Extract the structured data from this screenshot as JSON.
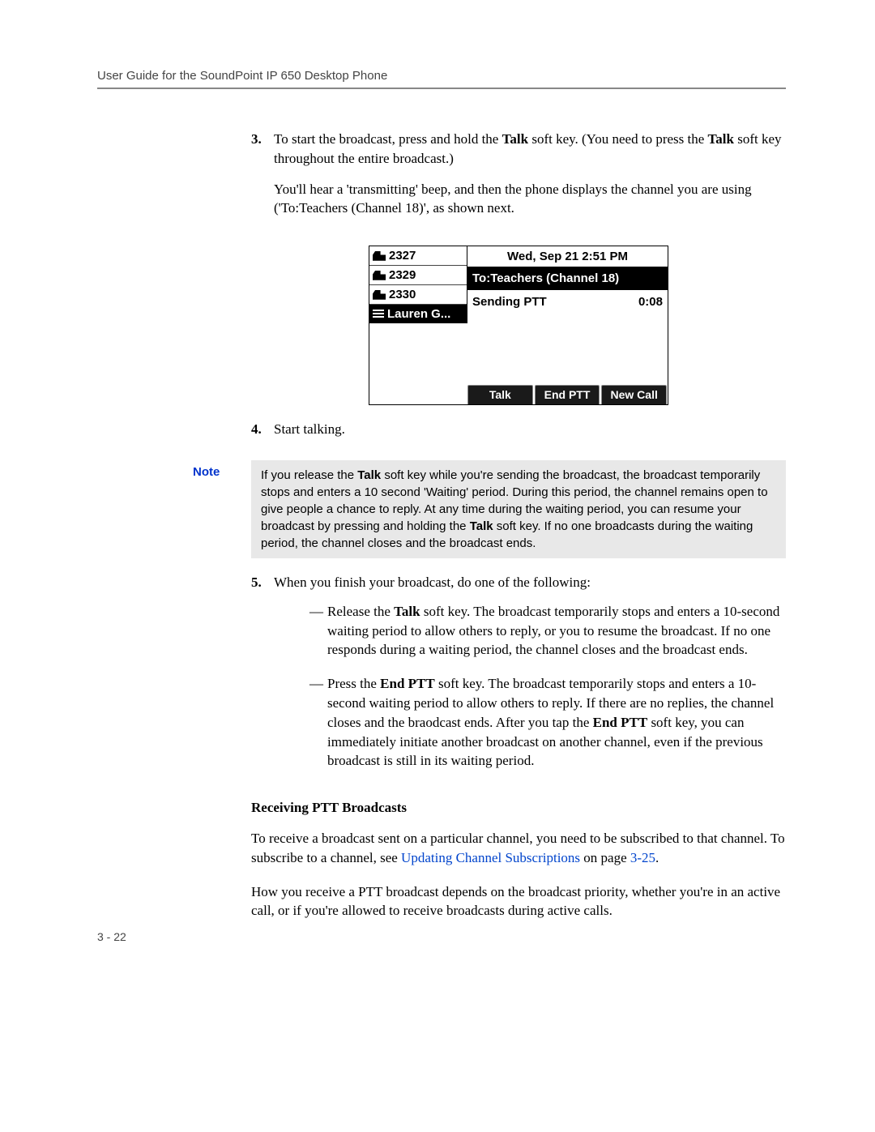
{
  "header": "User Guide for the SoundPoint IP 650 Desktop Phone",
  "step3": {
    "num": "3.",
    "text_a": "To start the broadcast, press and hold the ",
    "talk1": "Talk",
    "text_b": " soft key. (You need to press the ",
    "talk2": "Talk",
    "text_c": " soft key throughout the entire broadcast.)",
    "para2": "You'll hear a 'transmitting' beep, and then the phone displays the channel you are using ('To:Teachers (Channel 18)', as shown next."
  },
  "screen": {
    "lines": [
      {
        "label": "2327",
        "icon": "phone",
        "inv": false
      },
      {
        "label": "2329",
        "icon": "phone",
        "inv": false
      },
      {
        "label": "2330",
        "icon": "phone",
        "inv": false
      },
      {
        "label": "Lauren G...",
        "icon": "blds",
        "inv": true
      }
    ],
    "datetime": "Wed, Sep 21  2:51 PM",
    "main": "To:Teachers (Channel 18)",
    "status": "Sending PTT",
    "timer": "0:08",
    "softkeys": [
      "Talk",
      "End PTT",
      "New Call"
    ]
  },
  "step4": {
    "num": "4.",
    "text": "Start talking."
  },
  "note": {
    "label": "Note",
    "text_a": "If you release the ",
    "talk": "Talk",
    "text_b": " soft key while you're sending the broadcast, the broadcast temporarily stops and enters a 10 second 'Waiting' period. During this period, the channel remains open to give people a chance to reply. At any time during the waiting period, you can resume your broadcast by pressing and holding the ",
    "talk2": "Talk",
    "text_c": " soft key. If no one broadcasts during the waiting period, the channel closes and the broadcast ends."
  },
  "step5": {
    "num": "5.",
    "intro": "When you finish your broadcast, do one of the following:",
    "bullet1_a": "Release the ",
    "bullet1_talk": "Talk",
    "bullet1_b": " soft key. The broadcast temporarily stops and enters a 10-second waiting period to allow others to reply, or you to resume the broadcast. If no one responds during a waiting period, the channel closes and the broadcast ends.",
    "bullet2_a": "Press the ",
    "bullet2_end": "End PTT",
    "bullet2_b": " soft key. The broadcast temporarily stops and enters a 10-second waiting period to allow others to reply. If there are no replies, the channel closes and the braodcast ends. After you tap the ",
    "bullet2_end2": "End PTT",
    "bullet2_c": " soft key, you can immediately initiate another broadcast on another channel, even if the previous broadcast is still in its waiting period."
  },
  "recv": {
    "heading": "Receiving PTT Broadcasts",
    "p1_a": "To receive a broadcast sent on a particular channel, you need to be subscribed to that channel. To subscribe to a channel, see ",
    "link": "Updating Channel Subscriptions",
    "p1_b": " on page ",
    "pageref": "3-25",
    "p1_c": ".",
    "p2": "How you receive a PTT broadcast depends on the broadcast priority, whether you're in an active call, or if you're allowed to receive broadcasts during active calls."
  },
  "pagenum": "3 - 22",
  "dash": "—"
}
